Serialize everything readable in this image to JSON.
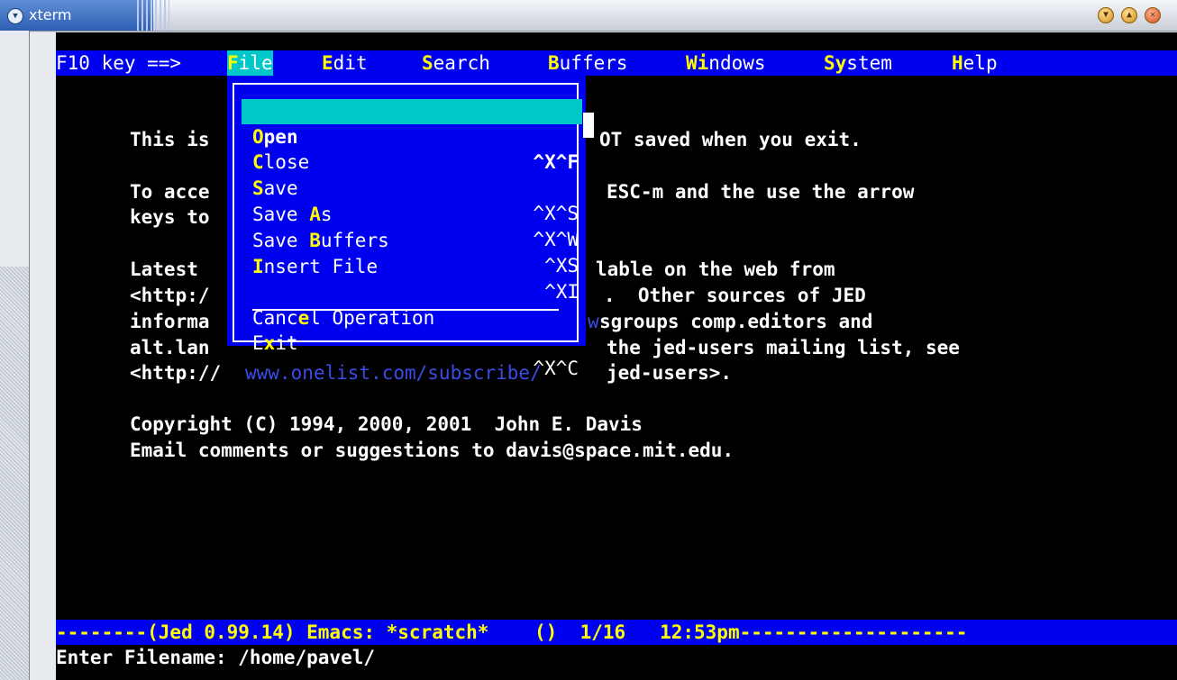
{
  "window": {
    "title": "xterm"
  },
  "menubar": {
    "prefix": "F10 key ==> ",
    "items": [
      {
        "hk": "F",
        "rest": "ile"
      },
      {
        "hk": "E",
        "rest": "dit"
      },
      {
        "hk": "S",
        "rest": "earch"
      },
      {
        "hk": "B",
        "rest": "uffers"
      },
      {
        "pre": "",
        "hk": "Wi",
        "rest": "ndows"
      },
      {
        "pre": "",
        "hk": "Sy",
        "rest": "stem"
      },
      {
        "hk": "H",
        "rest": "elp"
      }
    ]
  },
  "file_menu": {
    "items": [
      {
        "pre": "",
        "hk": "O",
        "rest": "pen",
        "shortcut": "^X^F"
      },
      {
        "pre": "",
        "hk": "C",
        "rest": "lose",
        "shortcut": ""
      },
      {
        "pre": "",
        "hk": "S",
        "rest": "ave",
        "shortcut": "^X^S"
      },
      {
        "pre": "Save ",
        "hk": "A",
        "rest": "s",
        "shortcut": "^X^W"
      },
      {
        "pre": "Save ",
        "hk": "B",
        "rest": "uffers",
        "shortcut": "^XS"
      },
      {
        "pre": "",
        "hk": "I",
        "rest": "nsert File",
        "shortcut": "^XI"
      },
      {
        "pre": "Canc",
        "hk": "e",
        "rest": "l Operation",
        "shortcut": ""
      },
      {
        "pre": "E",
        "hk": "x",
        "rest": "it",
        "shortcut": "^X^C"
      }
    ]
  },
  "buffer_lines": {
    "l1a": "This is",
    "l1b": "OT saved when you exit.",
    "l2a": "To acce",
    "l2b": "ESC-m and the use the arrow",
    "l3a": "keys to",
    "l4a": "Latest",
    "l4b": "lable on the web from",
    "l5a": "<http:/",
    "l5b": ".  Other sources of JED",
    "l6a": "informa",
    "l6link": "w",
    "l6b": "sgroups comp.editors and",
    "l7a": "alt.lan",
    "l7b": "the jed-users mailing list, see",
    "l8a": "<http://",
    "l8link": "www.onelist.com/subscribe/",
    "l8b": "jed-users>.",
    "l9": "Copyright (C) 1994, 2000, 2001  John E. Davis",
    "l10": "Email comments or suggestions to davis@space.mit.edu."
  },
  "status_line": "--------(Jed 0.99.14) Emacs: *scratch*    ()  1/16   12:53pm--------------------",
  "minibuffer": "Enter Filename: /home/pavel/"
}
